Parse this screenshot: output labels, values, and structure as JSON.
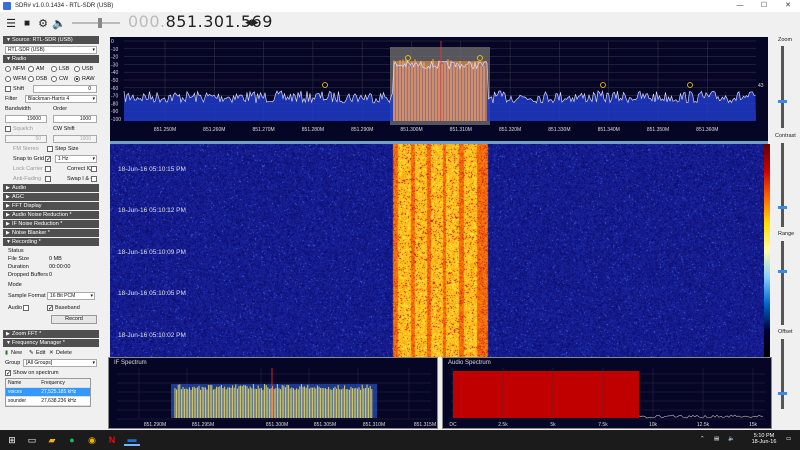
{
  "window": {
    "title": "SDR# v1.0.0.1434 - RTL-SDR (USB)",
    "controls": {
      "minimize": "—",
      "maximize": "☐",
      "close": "✕"
    }
  },
  "toolbar": {
    "frequency_dim": "000.",
    "frequency": "851.301.569",
    "icons": [
      "menu-icon",
      "stop-icon",
      "gear-icon",
      "speaker-icon"
    ]
  },
  "left_panel": {
    "source_section": "Source: RTL-SDR (USB)",
    "source_value": "RTL-SDR (USB)",
    "radio_section": "Radio",
    "modes": [
      {
        "label": "NFM",
        "selected": false
      },
      {
        "label": "AM",
        "selected": false
      },
      {
        "label": "LSB",
        "selected": false
      },
      {
        "label": "USB",
        "selected": false
      },
      {
        "label": "WFM",
        "selected": false
      },
      {
        "label": "DSB",
        "selected": false
      },
      {
        "label": "CW",
        "selected": false
      },
      {
        "label": "RAW",
        "selected": true
      }
    ],
    "shift_label": "Shift",
    "shift_value": "0",
    "filter_label": "Filter",
    "filter_value": "Blackman-Harris 4",
    "bandwidth_label": "Bandwidth",
    "order_label": "Order",
    "bandwidth_value": "19000",
    "order_value": "1000",
    "squelch_label": "Squelch",
    "cw_shift_label": "CW Shift",
    "squelch_value": "50",
    "cw_shift_value": "1000",
    "fm_stereo_label": "FM Stereo",
    "step_size_label": "Step Size",
    "snap_label": "Snap to Grid",
    "step_value": "1 Hz",
    "lock_carrier_label": "Lock Carrier",
    "correct_iq_label": "Correct IQ",
    "anti_fading_label": "Anti-Fading",
    "swap_iq_label": "Swap I & Q",
    "collapsed_sections": [
      "Audio",
      "AGC",
      "FFT Display",
      "Audio Noise Reduction *",
      "IF Noise Reduction *",
      "Noise Blanker *"
    ],
    "recording_section": "Recording *",
    "status_label": "Status",
    "file_size_label": "File Size",
    "file_size_value": "0 MB",
    "duration_label": "Duration",
    "duration_value": "00:00:00",
    "dropped_label": "Dropped Buffers",
    "dropped_value": "0",
    "mode_label": "Mode",
    "sample_format_label": "Sample Format",
    "sample_format_value": "16 Bit PCM",
    "audio_label": "Audio",
    "baseband_label": "Baseband",
    "record_button": "Record",
    "zoom_fft_section": "Zoom FFT *",
    "freq_manager_section": "Frequency Manager *",
    "new_label": "New",
    "edit_label": "Edit",
    "delete_label": "Delete",
    "group_label": "Group",
    "group_value": "[All Groups]",
    "show_spectrum_label": "Show on spectrum",
    "table_headers": [
      "Name",
      "Frequency"
    ],
    "table_rows": [
      {
        "name": "voices",
        "freq": "27,525.185 kHz",
        "selected": true
      },
      {
        "name": "sounder",
        "freq": "27,638.236 kHz",
        "selected": false
      }
    ]
  },
  "spectrum": {
    "db_ticks": [
      "0",
      "-10",
      "-20",
      "-30",
      "-40",
      "-50",
      "-60",
      "-70",
      "-80",
      "-90",
      "-100"
    ],
    "freq_ticks": [
      "851.250M",
      "851.260M",
      "851.270M",
      "851.280M",
      "851.290M",
      "851.300M",
      "851.310M",
      "851.320M",
      "851.330M",
      "851.340M",
      "851.350M",
      "851.360M"
    ],
    "right_value": "43"
  },
  "waterfall": {
    "timestamps": [
      "18-Jun-16 05:10:15 PM",
      "18-Jun-16 05:10:12 PM",
      "18-Jun-16 05:10:09 PM",
      "18-Jun-16 05:10:05 PM",
      "18-Jun-16 05:10:02 PM"
    ]
  },
  "right_sliders": {
    "zoom": "Zoom",
    "contrast": "Contrast",
    "range": "Range",
    "offset": "Offset"
  },
  "if_spectrum": {
    "title": "IF Spectrum",
    "ticks": [
      "851.290M",
      "851.295M",
      "851.300M",
      "851.305M",
      "851.310M",
      "851.315M"
    ]
  },
  "audio_spectrum": {
    "title": "Audio Spectrum",
    "ticks": [
      "DC",
      "2.5k",
      "5k",
      "7.5k",
      "10k",
      "12.5k",
      "15k"
    ]
  },
  "taskbar": {
    "time": "5:10 PM",
    "date": "18-Jun-16",
    "accent_colors": {
      "spotify": "#1db954",
      "chrome": "#f4b400",
      "netflix": "#e50914",
      "sdr": "#1e6fd9"
    }
  }
}
